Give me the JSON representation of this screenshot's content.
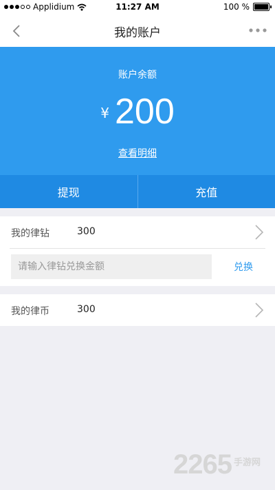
{
  "status_bar": {
    "carrier": "Applidium",
    "time": "11:27 AM",
    "battery": "100 %"
  },
  "nav": {
    "title": "我的账户",
    "icons": [
      "back-chevron-icon",
      "more-dots-icon"
    ]
  },
  "balance": {
    "label": "账户余额",
    "currency": "¥",
    "amount": "200",
    "detail_link": "查看明细"
  },
  "actions": {
    "withdraw": "提现",
    "recharge": "充值"
  },
  "lvzuan": {
    "label": "我的律钻",
    "value": "300",
    "input_placeholder": "请输入律钻兑换金额",
    "redeem_label": "兑换"
  },
  "lvbi": {
    "label": "我的律币",
    "value": "300"
  },
  "watermark": {
    "number": "2265",
    "text": "手游网"
  },
  "colors": {
    "primary": "#2f9bee",
    "action_bar": "#1f8ae3",
    "background": "#efeff4"
  }
}
